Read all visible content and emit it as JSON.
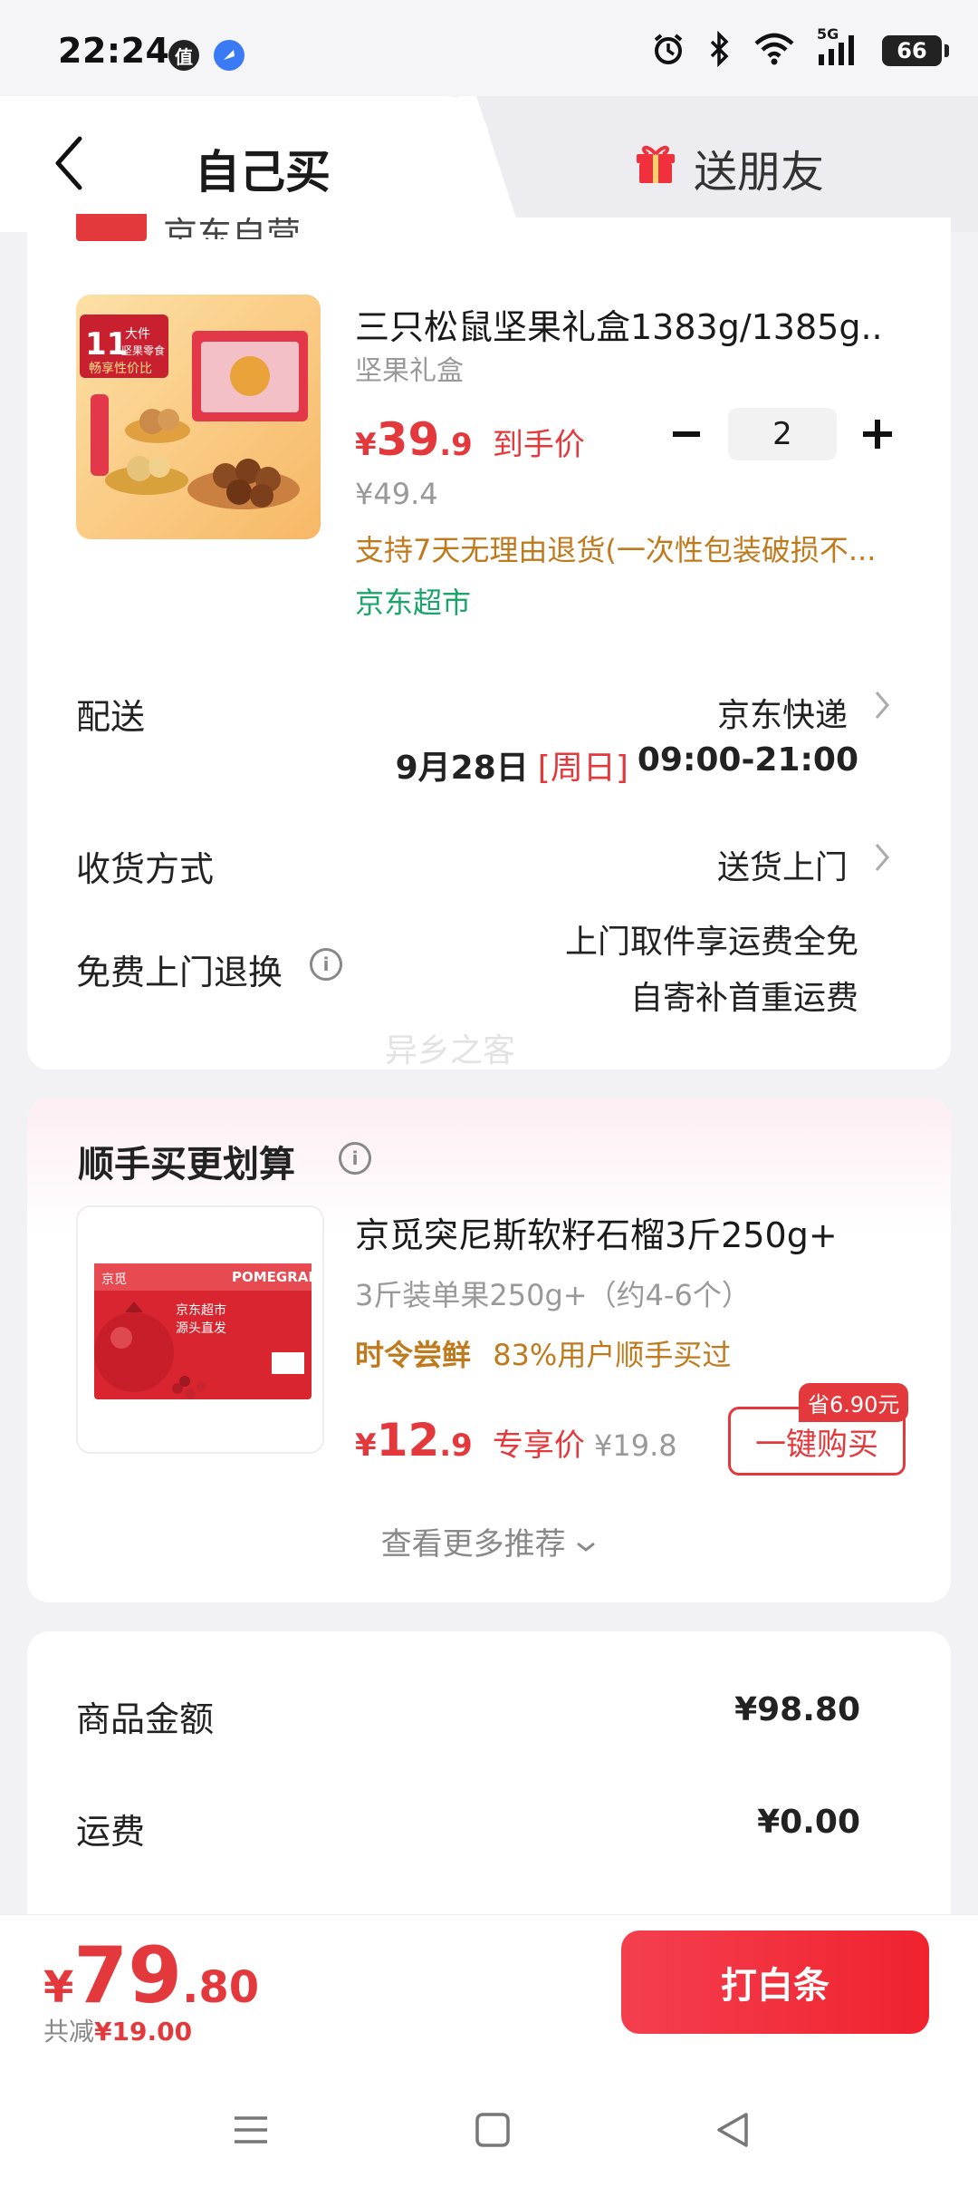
{
  "status_bar": {
    "time": "22:24",
    "badge1": "值",
    "network": "5G",
    "battery": "66"
  },
  "tabs": {
    "self": "自己买",
    "gift": "送朋友"
  },
  "shop": {
    "tag": "自营",
    "name": "京东自营"
  },
  "product": {
    "title": "三只松鼠坚果礼盒1383g/1385g...",
    "subtitle": "坚果礼盒",
    "price_yen": "¥",
    "price_int": "39",
    "price_dec": ".9",
    "price_label": "到手价",
    "original_price": "¥49.4",
    "policy": "支持7天无理由退货(一次性包装破损不...",
    "store": "京东超市",
    "quantity": "2",
    "image_text": {
      "badge_num": "11",
      "badge_l1": "大件",
      "badge_l2": "坚果零食",
      "slogan": "畅享性价比"
    }
  },
  "delivery": {
    "label": "配送",
    "carrier": "京东快递",
    "date": "9月28日",
    "weekday": "[周日]",
    "time": "09:00-21:00"
  },
  "receive": {
    "label": "收货方式",
    "value": "送货上门"
  },
  "return_service": {
    "label": "免费上门退换",
    "line1": "上门取件享运费全免",
    "line2": "自寄补首重运费"
  },
  "watermark": "异乡之客",
  "recommend": {
    "title": "顺手买更划算",
    "name": "京觅突尼斯软籽石榴3斤250g+",
    "spec": "3斤装单果250g+（约4-6个）",
    "tag1": "时令尝鲜",
    "tag2": "83%用户顺手买过",
    "price_yen": "¥",
    "price_int": "12",
    "price_dec": ".9",
    "price_label": "专享价",
    "original_price": "¥19.8",
    "save_badge": "省6.90元",
    "buy_label": "一键购买",
    "more": "查看更多推荐",
    "image_text": {
      "brand": "京觅",
      "box1": "京东超市",
      "box2": "源头直发",
      "word": "POMEGRANATE"
    }
  },
  "summary": {
    "goods_label": "商品金额",
    "goods_value": "¥98.80",
    "freight_label": "运费",
    "freight_value": "¥0.00"
  },
  "checkout": {
    "total_yen": "¥",
    "total_int": "79",
    "total_dec": ".80",
    "discount_label": "共减",
    "discount_value": "¥19.00",
    "pay_label": "打白条"
  },
  "colors": {
    "accent": "#e4393c",
    "policy": "#c07a1e",
    "store": "#1aa56b"
  }
}
